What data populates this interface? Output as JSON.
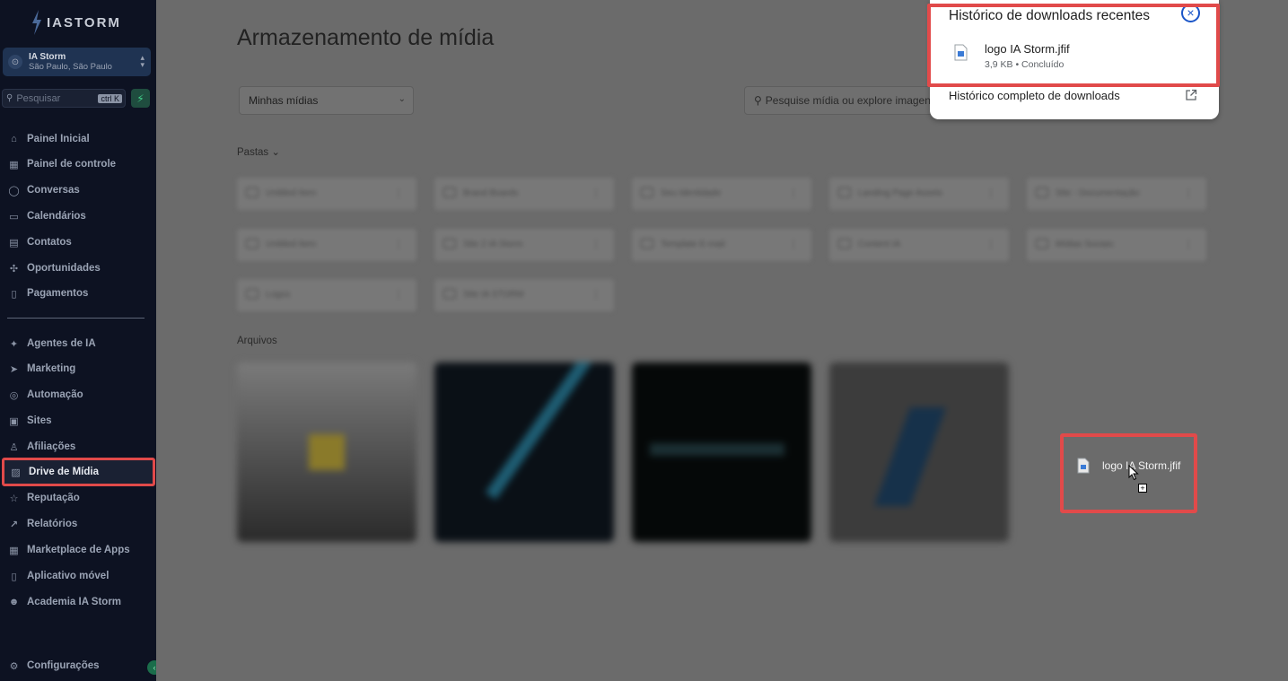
{
  "app": {
    "logo_text": "IASTORM",
    "account_name": "IA Storm",
    "account_location": "São Paulo, São Paulo",
    "search_placeholder": "Pesquisar",
    "search_shortcut": "ctrl K"
  },
  "sidebar": {
    "items": [
      {
        "label": "Painel Inicial",
        "icon": "home-icon"
      },
      {
        "label": "Painel de controle",
        "icon": "dashboard-icon"
      },
      {
        "label": "Conversas",
        "icon": "chat-icon"
      },
      {
        "label": "Calendários",
        "icon": "calendar-icon"
      },
      {
        "label": "Contatos",
        "icon": "contacts-icon"
      },
      {
        "label": "Oportunidades",
        "icon": "opportunities-icon"
      },
      {
        "label": "Pagamentos",
        "icon": "payments-icon"
      },
      {
        "label": "Agentes de IA",
        "icon": "ai-agents-icon"
      },
      {
        "label": "Marketing",
        "icon": "send-icon"
      },
      {
        "label": "Automação",
        "icon": "automation-icon"
      },
      {
        "label": "Sites",
        "icon": "sites-icon"
      },
      {
        "label": "Afiliações",
        "icon": "affiliate-icon"
      },
      {
        "label": "Drive de Mídia",
        "icon": "image-icon",
        "active": true
      },
      {
        "label": "Reputação",
        "icon": "star-icon"
      },
      {
        "label": "Relatórios",
        "icon": "trend-icon"
      },
      {
        "label": "Marketplace de Apps",
        "icon": "apps-icon"
      },
      {
        "label": "Aplicativo móvel",
        "icon": "mobile-icon"
      },
      {
        "label": "Academia IA Storm",
        "icon": "users-icon"
      }
    ],
    "settings_label": "Configurações"
  },
  "main": {
    "title": "Armazenamento de mídia",
    "filter_selected": "Minhas mídias",
    "search_placeholder": "Pesquise mídia ou explore imagens",
    "folders_label": "Pastas",
    "files_label": "Arquivos",
    "folders": [
      "Untitled Item",
      "Brand Boards",
      "Seu Identidade",
      "Landing Page Assets",
      "Site - Documentação",
      "Untitled Item",
      "Site 2 IA Storm",
      "Template E-mail",
      "Content IA",
      "Mídias Sociais",
      "Logos",
      "Site IA STORM"
    ]
  },
  "downloads_popup": {
    "title": "Histórico de downloads recentes",
    "file_name": "logo IA Storm.jfif",
    "file_meta": "3,9 KB • Concluído",
    "full_history_label": "Histórico completo de downloads"
  },
  "drag": {
    "file_label": "logo IA Storm.jfif"
  },
  "colors": {
    "sidebar_bg": "#0d1222",
    "highlight": "#e14a4a",
    "accent_blue": "#1a55c8"
  }
}
